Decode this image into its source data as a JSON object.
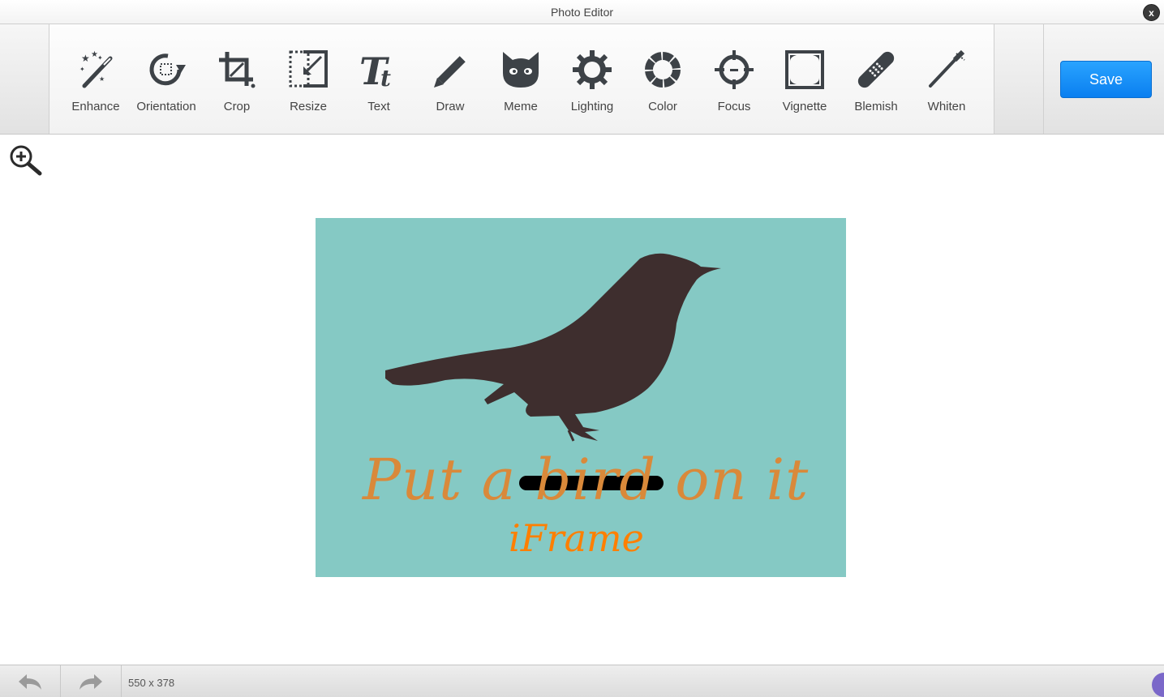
{
  "window": {
    "title": "Photo Editor",
    "close_label": "x"
  },
  "toolbar": {
    "tools": [
      {
        "label": "Enhance",
        "icon": "magic-wand-icon"
      },
      {
        "label": "Orientation",
        "icon": "rotate-icon"
      },
      {
        "label": "Crop",
        "icon": "crop-icon"
      },
      {
        "label": "Resize",
        "icon": "resize-icon"
      },
      {
        "label": "Text",
        "icon": "text-icon"
      },
      {
        "label": "Draw",
        "icon": "pencil-icon"
      },
      {
        "label": "Meme",
        "icon": "cat-face-icon"
      },
      {
        "label": "Lighting",
        "icon": "sun-icon"
      },
      {
        "label": "Color",
        "icon": "color-ring-icon"
      },
      {
        "label": "Focus",
        "icon": "crosshair-icon"
      },
      {
        "label": "Vignette",
        "icon": "vignette-frame-icon"
      },
      {
        "label": "Blemish",
        "icon": "bandage-icon"
      },
      {
        "label": "Whiten",
        "icon": "toothbrush-icon"
      }
    ],
    "save_label": "Save"
  },
  "canvas": {
    "zoom_icon": "zoom-in-icon",
    "image": {
      "subject": "bird-silhouette",
      "text_main": "Put a bird on it",
      "text_overlay": "iFrame",
      "background_color": "#85c9c4"
    }
  },
  "statusbar": {
    "undo_icon": "undo-icon",
    "redo_icon": "redo-icon",
    "dimensions": "550 x 378"
  },
  "colors": {
    "accent": "#1089f7",
    "icon": "#3d4247"
  }
}
